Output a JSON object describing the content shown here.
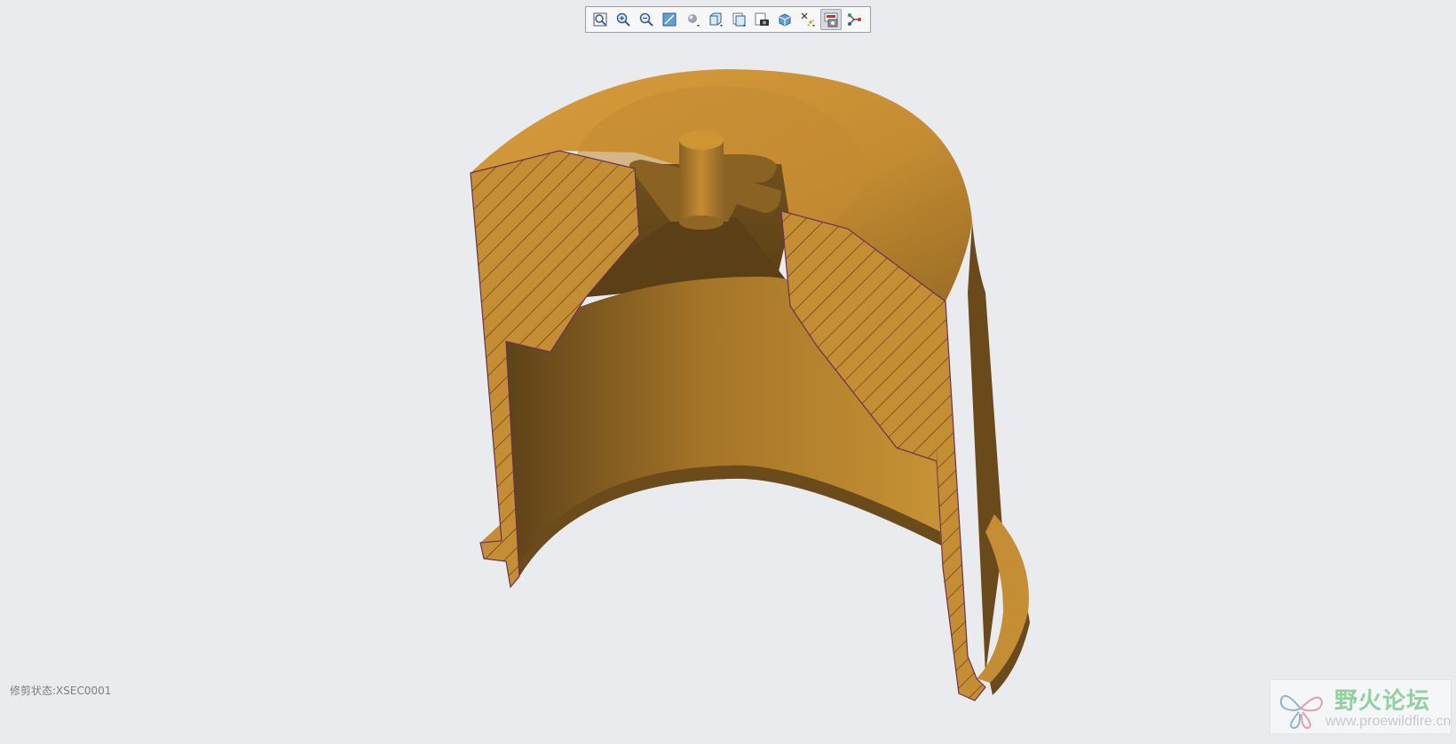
{
  "toolbar": {
    "buttons": [
      {
        "icon": "zoom-fit-icon"
      },
      {
        "icon": "zoom-in-icon"
      },
      {
        "icon": "zoom-out-icon"
      },
      {
        "icon": "reorient-icon"
      },
      {
        "icon": "display-style-icon"
      },
      {
        "icon": "saved-views-icon"
      },
      {
        "icon": "view-manager-icon"
      },
      {
        "icon": "snapshot-icon"
      },
      {
        "icon": "perspective-icon"
      },
      {
        "icon": "datum-display-icon"
      },
      {
        "icon": "section-view-icon",
        "active": true
      },
      {
        "icon": "annotation-display-icon"
      }
    ]
  },
  "status": {
    "text": "修剪状态:XSEC0001"
  },
  "watermark": {
    "title": "野火论坛",
    "url": "www.proewildfire.cn"
  },
  "colors": {
    "background": "#e9ebee",
    "model_light": "#cf9535",
    "model_mid": "#a8772a",
    "model_dark": "#6b4b1c",
    "section_outline": "#6b2f5a"
  }
}
